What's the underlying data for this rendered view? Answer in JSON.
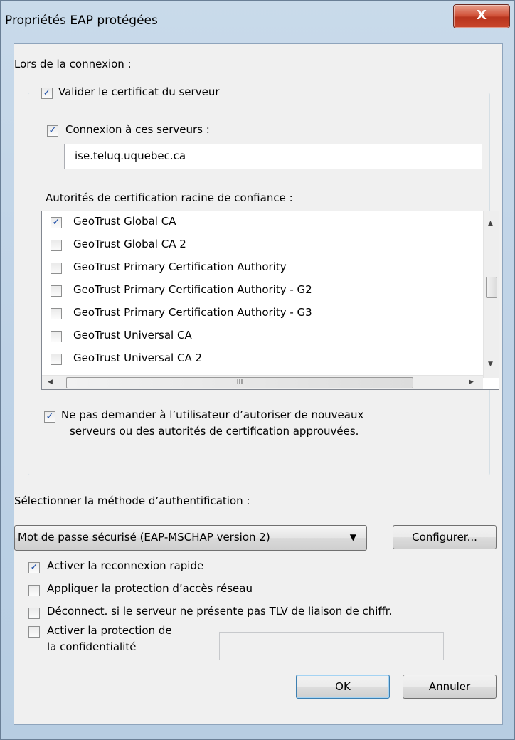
{
  "window": {
    "title": "Propriétés EAP protégées",
    "close_label": "X"
  },
  "connection": {
    "heading": "Lors de la connexion :",
    "validate_cert_label": "Valider le certificat du serveur",
    "validate_cert_checked": true,
    "connect_servers_label": "Connexion à ces serveurs :",
    "connect_servers_checked": true,
    "server_value": "ise.teluq.uquebec.ca",
    "ca_heading": "Autorités de certification racine de confiance :",
    "ca_list": [
      {
        "label": "GeoTrust Global CA",
        "checked": true
      },
      {
        "label": "GeoTrust Global CA 2",
        "checked": false
      },
      {
        "label": "GeoTrust Primary Certification Authority",
        "checked": false
      },
      {
        "label": "GeoTrust Primary Certification Authority - G2",
        "checked": false
      },
      {
        "label": "GeoTrust Primary Certification Authority - G3",
        "checked": false
      },
      {
        "label": "GeoTrust Universal CA",
        "checked": false
      },
      {
        "label": "GeoTrust Universal CA 2",
        "checked": false
      }
    ],
    "hscroll_thumb_label": "III",
    "no_prompt_line1": "Ne pas demander à l’utilisateur d’autoriser de nouveaux",
    "no_prompt_line2": "serveurs ou des autorités de certification approuvées.",
    "no_prompt_checked": true
  },
  "auth": {
    "heading": "Sélectionner la méthode d’authentification :",
    "method_value": "Mot de passe sécurisé (EAP-MSCHAP version 2)",
    "configure_label": "Configurer...",
    "options": [
      {
        "label": "Activer la reconnexion rapide",
        "checked": true
      },
      {
        "label": "Appliquer la protection d’accès réseau",
        "checked": false
      },
      {
        "label": "Déconnect. si le serveur ne présente pas TLV de liaison de chiffr.",
        "checked": false
      }
    ],
    "privacy_line1": "Activer la protection de",
    "privacy_line2": "la confidentialité",
    "privacy_checked": false,
    "privacy_value": ""
  },
  "buttons": {
    "ok_label": "OK",
    "cancel_label": "Annuler"
  },
  "colors": {
    "title_bar": "#bed2e6",
    "close_button": "#c9462c",
    "dialog_bg": "#f0f0f0",
    "checkmark": "#1e4fa8"
  }
}
